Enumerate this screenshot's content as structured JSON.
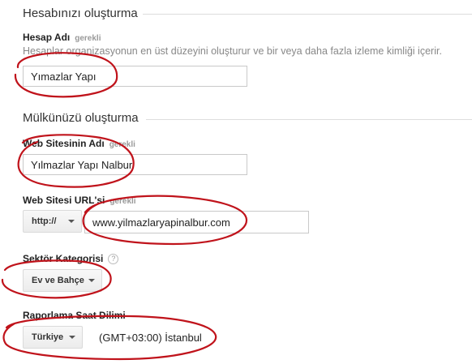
{
  "account": {
    "section_title": "Hesabınızı oluşturma",
    "name_label": "Hesap Adı",
    "required": "gerekli",
    "help": "Hesaplar organizasyonun en üst düzeyini oluşturur ve bir veya daha fazla izleme kimliği içerir.",
    "name_value": "Yımazlar Yapı"
  },
  "property": {
    "section_title": "Mülkünüzü oluşturma",
    "site_name_label": "Web Sitesinin Adı",
    "site_name_required": "gerekli",
    "site_name_value": "Yılmazlar Yapı Nalbur",
    "url_label": "Web Sitesi URL'si",
    "url_required": "gerekli",
    "protocol": "http://",
    "url_value": "www.yilmazlaryapinalbur.com",
    "industry_label": "Sektör Kategorisi",
    "help_icon": "?",
    "industry_value": "Ev ve Bahçe",
    "timezone_label": "Raporlama Saat Dilimi",
    "country_value": "Türkiye",
    "timezone_value": "(GMT+03:00) İstanbul"
  },
  "annotation_color": "#c0131b"
}
